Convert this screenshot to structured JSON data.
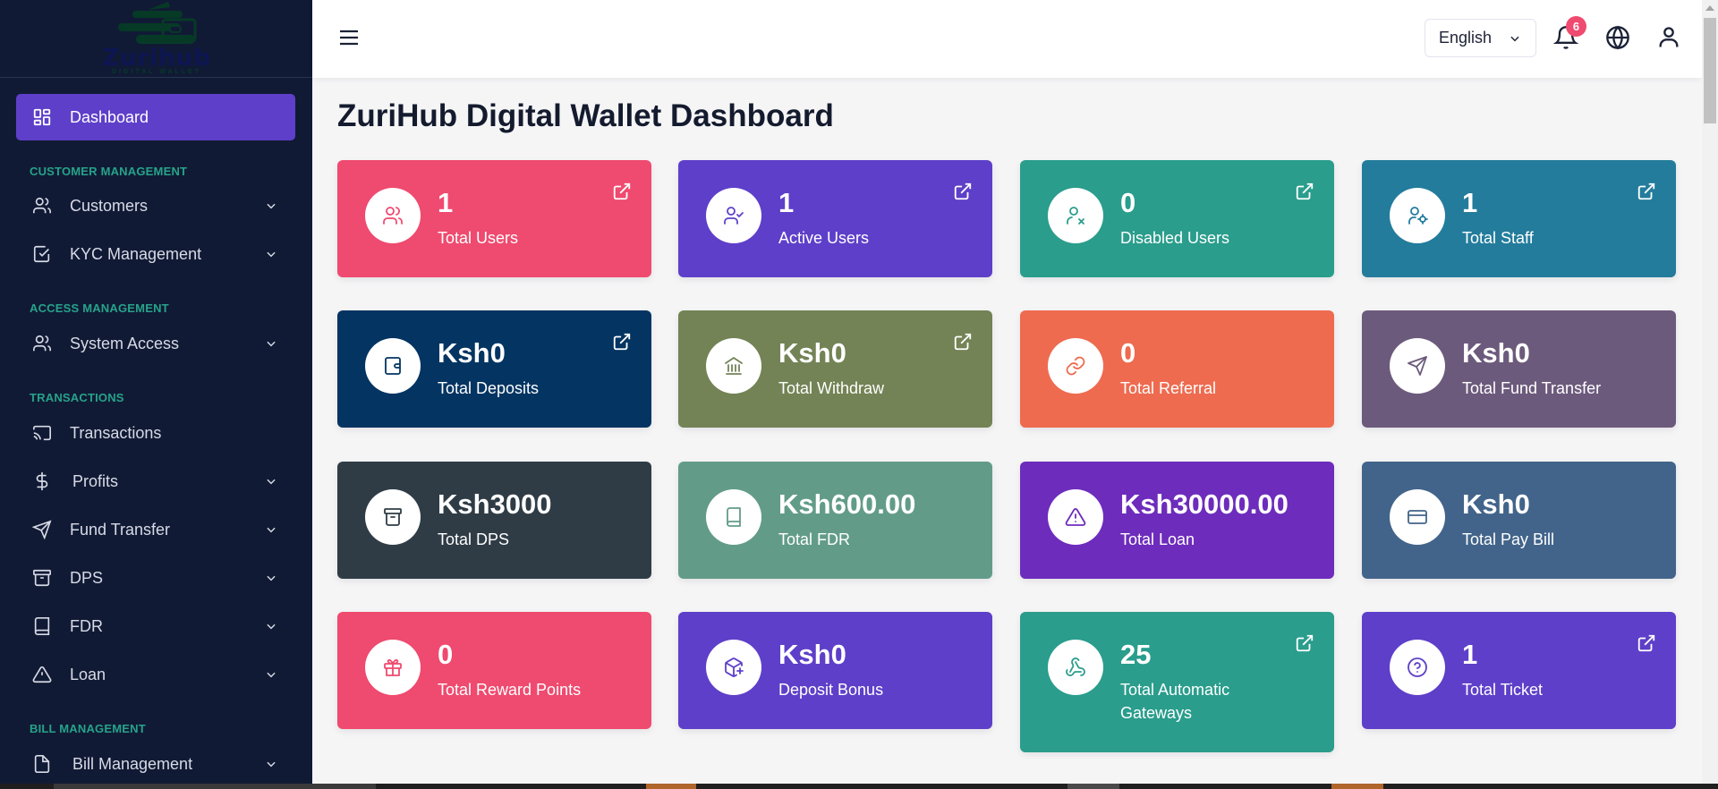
{
  "brand": {
    "logo_name": "Zurihub",
    "logo_subtitle": "DIGITAL WALLET"
  },
  "sidebar": {
    "active": {
      "label": "Dashboard",
      "icon": "dashboard-grid-icon"
    },
    "sections": [
      {
        "label": "CUSTOMER MANAGEMENT"
      },
      {
        "label": "ACCESS MANAGEMENT"
      },
      {
        "label": "TRANSACTIONS"
      },
      {
        "label": "BILL MANAGEMENT"
      }
    ],
    "items": [
      {
        "label": "Customers",
        "icon": "users-icon",
        "expandable": true
      },
      {
        "label": "KYC Management",
        "icon": "checkbox-icon",
        "expandable": true
      },
      {
        "label": "System Access",
        "icon": "users-icon",
        "expandable": true
      },
      {
        "label": "Transactions",
        "icon": "cast-icon",
        "expandable": false
      },
      {
        "label": "Profits",
        "icon": "dollar-icon",
        "expandable": true
      },
      {
        "label": "Fund Transfer",
        "icon": "send-icon",
        "expandable": true
      },
      {
        "label": "DPS",
        "icon": "archive-icon",
        "expandable": true
      },
      {
        "label": "FDR",
        "icon": "book-icon",
        "expandable": true
      },
      {
        "label": "Loan",
        "icon": "alert-triangle-icon",
        "expandable": true
      },
      {
        "label": "Bill Management",
        "icon": "file-icon",
        "expandable": true
      }
    ]
  },
  "header": {
    "language": "English",
    "notification_count": "6",
    "icons": [
      "menu-icon",
      "bell-icon",
      "globe-icon",
      "user-icon"
    ]
  },
  "page": {
    "title": "ZuriHub Digital Wallet Dashboard"
  },
  "cards": [
    {
      "value": "1",
      "label": "Total Users",
      "color": "#ef4a6f",
      "icon": "users-icon",
      "link": true
    },
    {
      "value": "1",
      "label": "Active Users",
      "color": "#5e3fc9",
      "icon": "user-check-icon",
      "link": true
    },
    {
      "value": "0",
      "label": "Disabled Users",
      "color": "#2a9d8c",
      "icon": "user-x-icon",
      "link": true
    },
    {
      "value": "1",
      "label": "Total Staff",
      "color": "#237c9c",
      "icon": "user-cog-icon",
      "link": true
    },
    {
      "value": "Ksh0",
      "label": "Total Deposits",
      "color": "#033462",
      "icon": "wallet-icon",
      "link": true
    },
    {
      "value": "Ksh0",
      "label": "Total Withdraw",
      "color": "#738355",
      "icon": "bank-icon",
      "link": true
    },
    {
      "value": "0",
      "label": "Total Referral",
      "color": "#ee6b4f",
      "icon": "link-icon",
      "link": false
    },
    {
      "value": "Ksh0",
      "label": "Total Fund Transfer",
      "color": "#6c5a7c",
      "icon": "send-icon",
      "link": false
    },
    {
      "value": "Ksh3000",
      "label": "Total DPS",
      "color": "#2f3c46",
      "icon": "archive-icon",
      "link": false
    },
    {
      "value": "Ksh600.00",
      "label": "Total FDR",
      "color": "#629c89",
      "icon": "book-icon",
      "link": false
    },
    {
      "value": "Ksh30000.00",
      "label": "Total Loan",
      "color": "#6d2cbc",
      "icon": "alert-triangle-icon",
      "link": false
    },
    {
      "value": "Ksh0",
      "label": "Total Pay Bill",
      "color": "#42648a",
      "icon": "credit-card-icon",
      "link": false
    },
    {
      "value": "0",
      "label": "Total Reward Points",
      "color": "#ef4a6f",
      "icon": "gift-icon",
      "link": false
    },
    {
      "value": "Ksh0",
      "label": "Deposit Bonus",
      "color": "#5e3fc9",
      "icon": "package-plus-icon",
      "link": false
    },
    {
      "value": "25",
      "label": "Total Automatic Gateways",
      "color": "#2a9d8c",
      "icon": "webhook-icon",
      "link": true
    },
    {
      "value": "1",
      "label": "Total Ticket",
      "color": "#5e3fc9",
      "icon": "help-circle-icon",
      "link": true
    }
  ]
}
